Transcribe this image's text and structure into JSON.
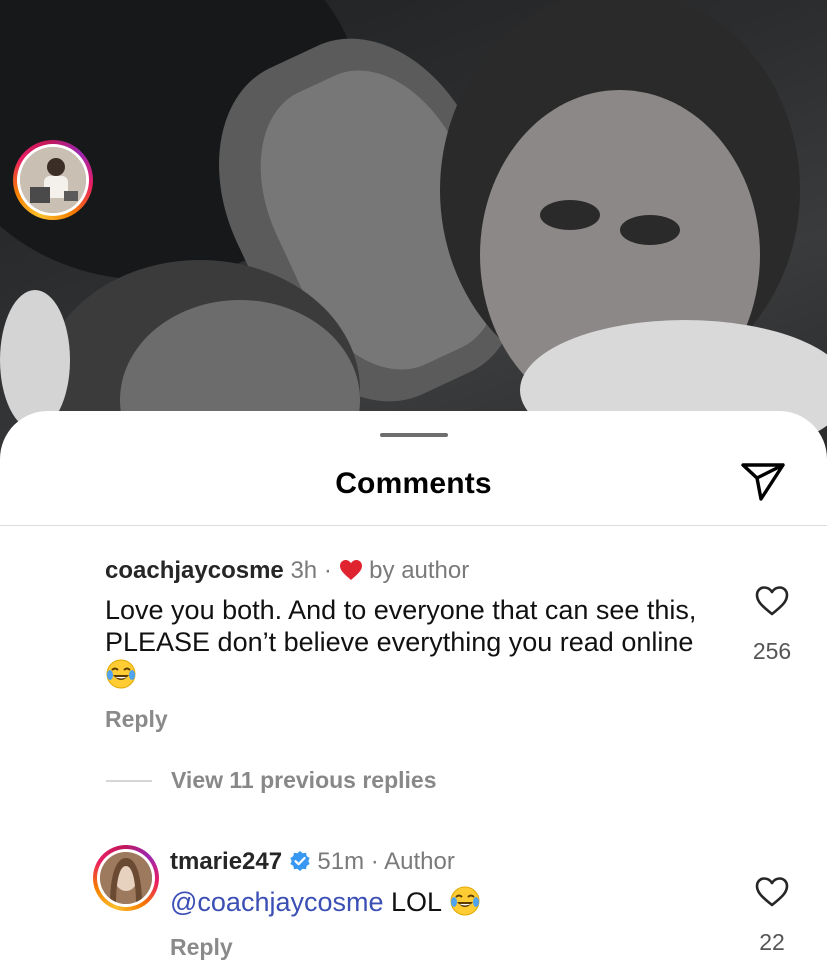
{
  "sheet": {
    "title": "Comments"
  },
  "comments": [
    {
      "username": "coachjaycosme",
      "time": "3h",
      "separator": "·",
      "liked_by_author": "by author",
      "text": "Love you both. And to everyone that can see this, PLEASE don’t believe everything you read online",
      "emoji": "joy-emoji",
      "reply_label": "Reply",
      "like_count": "256"
    }
  ],
  "thread": {
    "view_replies_label": "View 11 previous replies"
  },
  "replies": [
    {
      "username": "tmarie247",
      "verified": true,
      "time": "51m",
      "separator": "·",
      "role": "Author",
      "mention": "@coachjaycosme",
      "text": "LOL",
      "emoji": "joy-emoji",
      "reply_label": "Reply",
      "like_count": "22"
    }
  ],
  "colors": {
    "mention": "#3b4fb4",
    "heart": "#e0242f",
    "verified": "#3897f0"
  },
  "icons": [
    "share-icon",
    "heart-outline-icon",
    "heart-filled-icon",
    "verified-badge-icon",
    "joy-emoji"
  ]
}
